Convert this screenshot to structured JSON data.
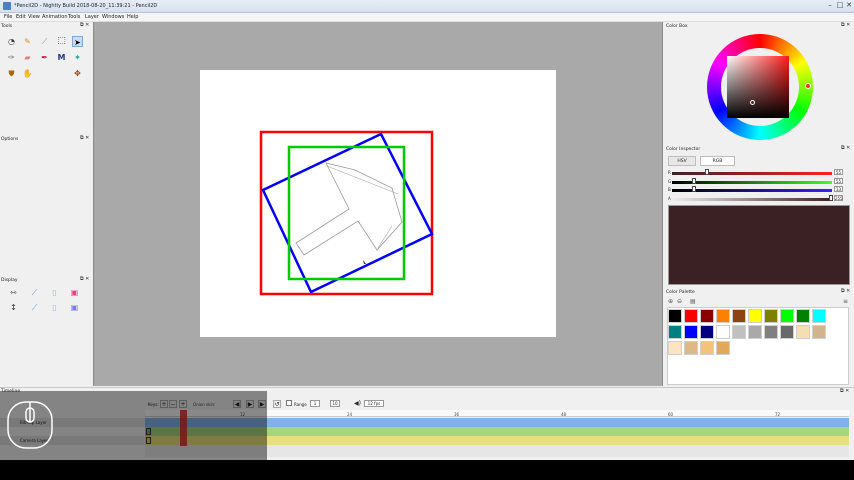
{
  "window": {
    "title": "*Pencil2D - Nightly Build 2018-08-20_11:39:21 - Pencil2D",
    "controls": [
      "–",
      "□",
      "✕"
    ]
  },
  "menu": [
    "File",
    "Edit",
    "View",
    "Animation",
    "Tools",
    "Layer",
    "Windows",
    "Help"
  ],
  "panels": {
    "tools": "Tools",
    "options": "Options",
    "display": "Display",
    "color_box": "Color Box",
    "color_inspector": "Color Inspector",
    "color_palette": "Color Palette",
    "timeline": "Timeline"
  },
  "inspector": {
    "tabs": [
      "HSV",
      "RGB"
    ],
    "active_tab": "RGB",
    "channels": [
      {
        "label": "R",
        "value": "55"
      },
      {
        "label": "G",
        "value": "55"
      },
      {
        "label": "B",
        "value": "33"
      },
      {
        "label": "A",
        "value": "255"
      }
    ],
    "preview_color": "#3b2124"
  },
  "palette": {
    "colors": [
      "#000000",
      "#ff0000",
      "#8b0000",
      "#ff8000",
      "#8b4513",
      "#ffff00",
      "#808000",
      "#00ff00",
      "#008000",
      "#00ffff",
      "#008080",
      "#0000ff",
      "#000080",
      "#ffffff",
      "#c0c0c0",
      "#a9a9a9",
      "#808080",
      "#696969",
      "#f5deb3",
      "#d2b48c",
      "#ffe4c4",
      "#deb887",
      "#f4c27a",
      "#e3a857"
    ]
  },
  "timeline": {
    "keys_label": "Keys:",
    "onion_label": "Onion skin:",
    "range_label": "Range",
    "range_start": "1",
    "range_end": "10",
    "fps": "12 fps",
    "ruler": [
      "12",
      "24",
      "36",
      "48",
      "60",
      "72"
    ],
    "layers": [
      {
        "name": "Bitmap Layer"
      },
      {
        "name": "Camera Layer"
      }
    ]
  },
  "colors": {
    "red_frame": "#ff0000",
    "blue_frame": "#0000ff",
    "green_frame": "#00cc00"
  }
}
